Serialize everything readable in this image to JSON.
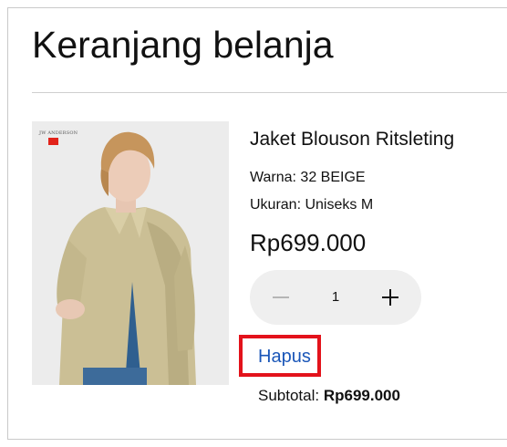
{
  "cart": {
    "title": "Keranjang belanja"
  },
  "item": {
    "name": "Jaket Blouson Ritsleting",
    "color_label": "Warna: 32 BEIGE",
    "size_label": "Ukuran: Uniseks M",
    "price": "Rp699.000",
    "quantity": "1",
    "remove_label": "Hapus",
    "subtotal_label": "Subtotal:",
    "subtotal_value": "Rp699.000",
    "image": {
      "brand_text": "JW ANDERSON",
      "brand_logo_text": "UNIQLO"
    }
  },
  "colors": {
    "link": "#1a56b8",
    "highlight_border": "#e3121b",
    "stepper_bg": "#efefef"
  },
  "icons": {
    "decrease": "minus-icon",
    "increase": "plus-icon"
  }
}
